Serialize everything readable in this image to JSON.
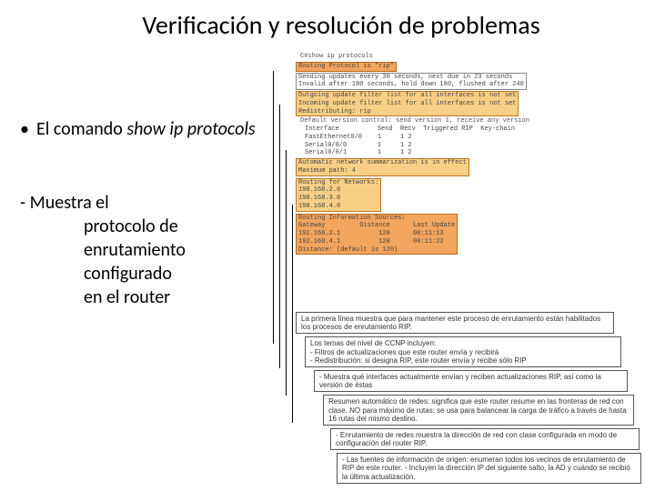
{
  "title": "Verificación y resolución de problemas",
  "bullet": {
    "dot": "•",
    "text_prefix": "El comando ",
    "command": "show ip protocols"
  },
  "sub": {
    "lead": "- Muestra el",
    "l1": "protocolo de",
    "l2": "enrutamiento",
    "l3": "configurado",
    "l4": "en el router"
  },
  "term": {
    "cmd_line": "C#show ip protocols",
    "proto": "Routing Protocol is \"rip\"",
    "updates": "Sending updates every 30 seconds, next due in 23 seconds",
    "invalid": "Invalid after 180 seconds, hold down 180, flushed after 240",
    "out_filter": "Outgoing update filter list for all interfaces is not set",
    "in_filter": "Incoming update filter list for all interfaces is not set",
    "redist": "Redistributing: rip",
    "version": "Default version control: send version 1, receive any version",
    "iface_header": "Interface          Send  Recv  Triggered RIP  Key-chain",
    "iface1": "FastEthernet0/0    1     1 2",
    "iface2": "Serial0/0/0        1     1 2",
    "iface3": "Serial0/0/1        1     1 2",
    "autosum": "Automatic network summarization is in effect",
    "maxpath": "Maximum path: 4",
    "routing_for": "Routing for Networks:",
    "net1": "198.168.2.0",
    "net2": "198.168.3.0",
    "net3": "198.168.4.0",
    "ris_header": "Routing Information Sources:",
    "ris_cols": "Gateway         Distance      Last Update",
    "ris1": "192.168.2.1          120      00:11:13",
    "ris2": "192.168.4.1          120      00:11:22",
    "ris_dist": "Distance: (default is 120)"
  },
  "callouts": {
    "c1": "La primera línea muestra que para mantener este proceso de enrutamiento están habilitados los procesos de enrutamiento RIP.",
    "c2": "Los temas del nivel de CCNP incluyen:",
    "c2a": "- Filtros de actualizaciones que este router envía y recibirá",
    "c2b": "- Redistribución: si designa RIP, este router envía y recibe sólo RIP",
    "c3": "- Muestra qué interfaces actualmente envían y reciben actualizaciones RIP, así como la versión de éstas",
    "c4": "Resumen automático de redes: significa que este router resume en las fronteras de red con clase. NO para máximo de rutas: se usa para balancear la carga de tráfico a través de hasta 16 rutas del mismo destino.",
    "c5": "- Enrutamiento de redes muestra la dirección de red con clase configurada en modo de configuración del router RIP.",
    "c6": "- Las fuentes de información de origen: enumeran todos los vecinos de enrutamiento de RIP de este router. - Incluyen la dirección IP del siguiente salto, la AD y cuándo se recibió la última actualización."
  }
}
